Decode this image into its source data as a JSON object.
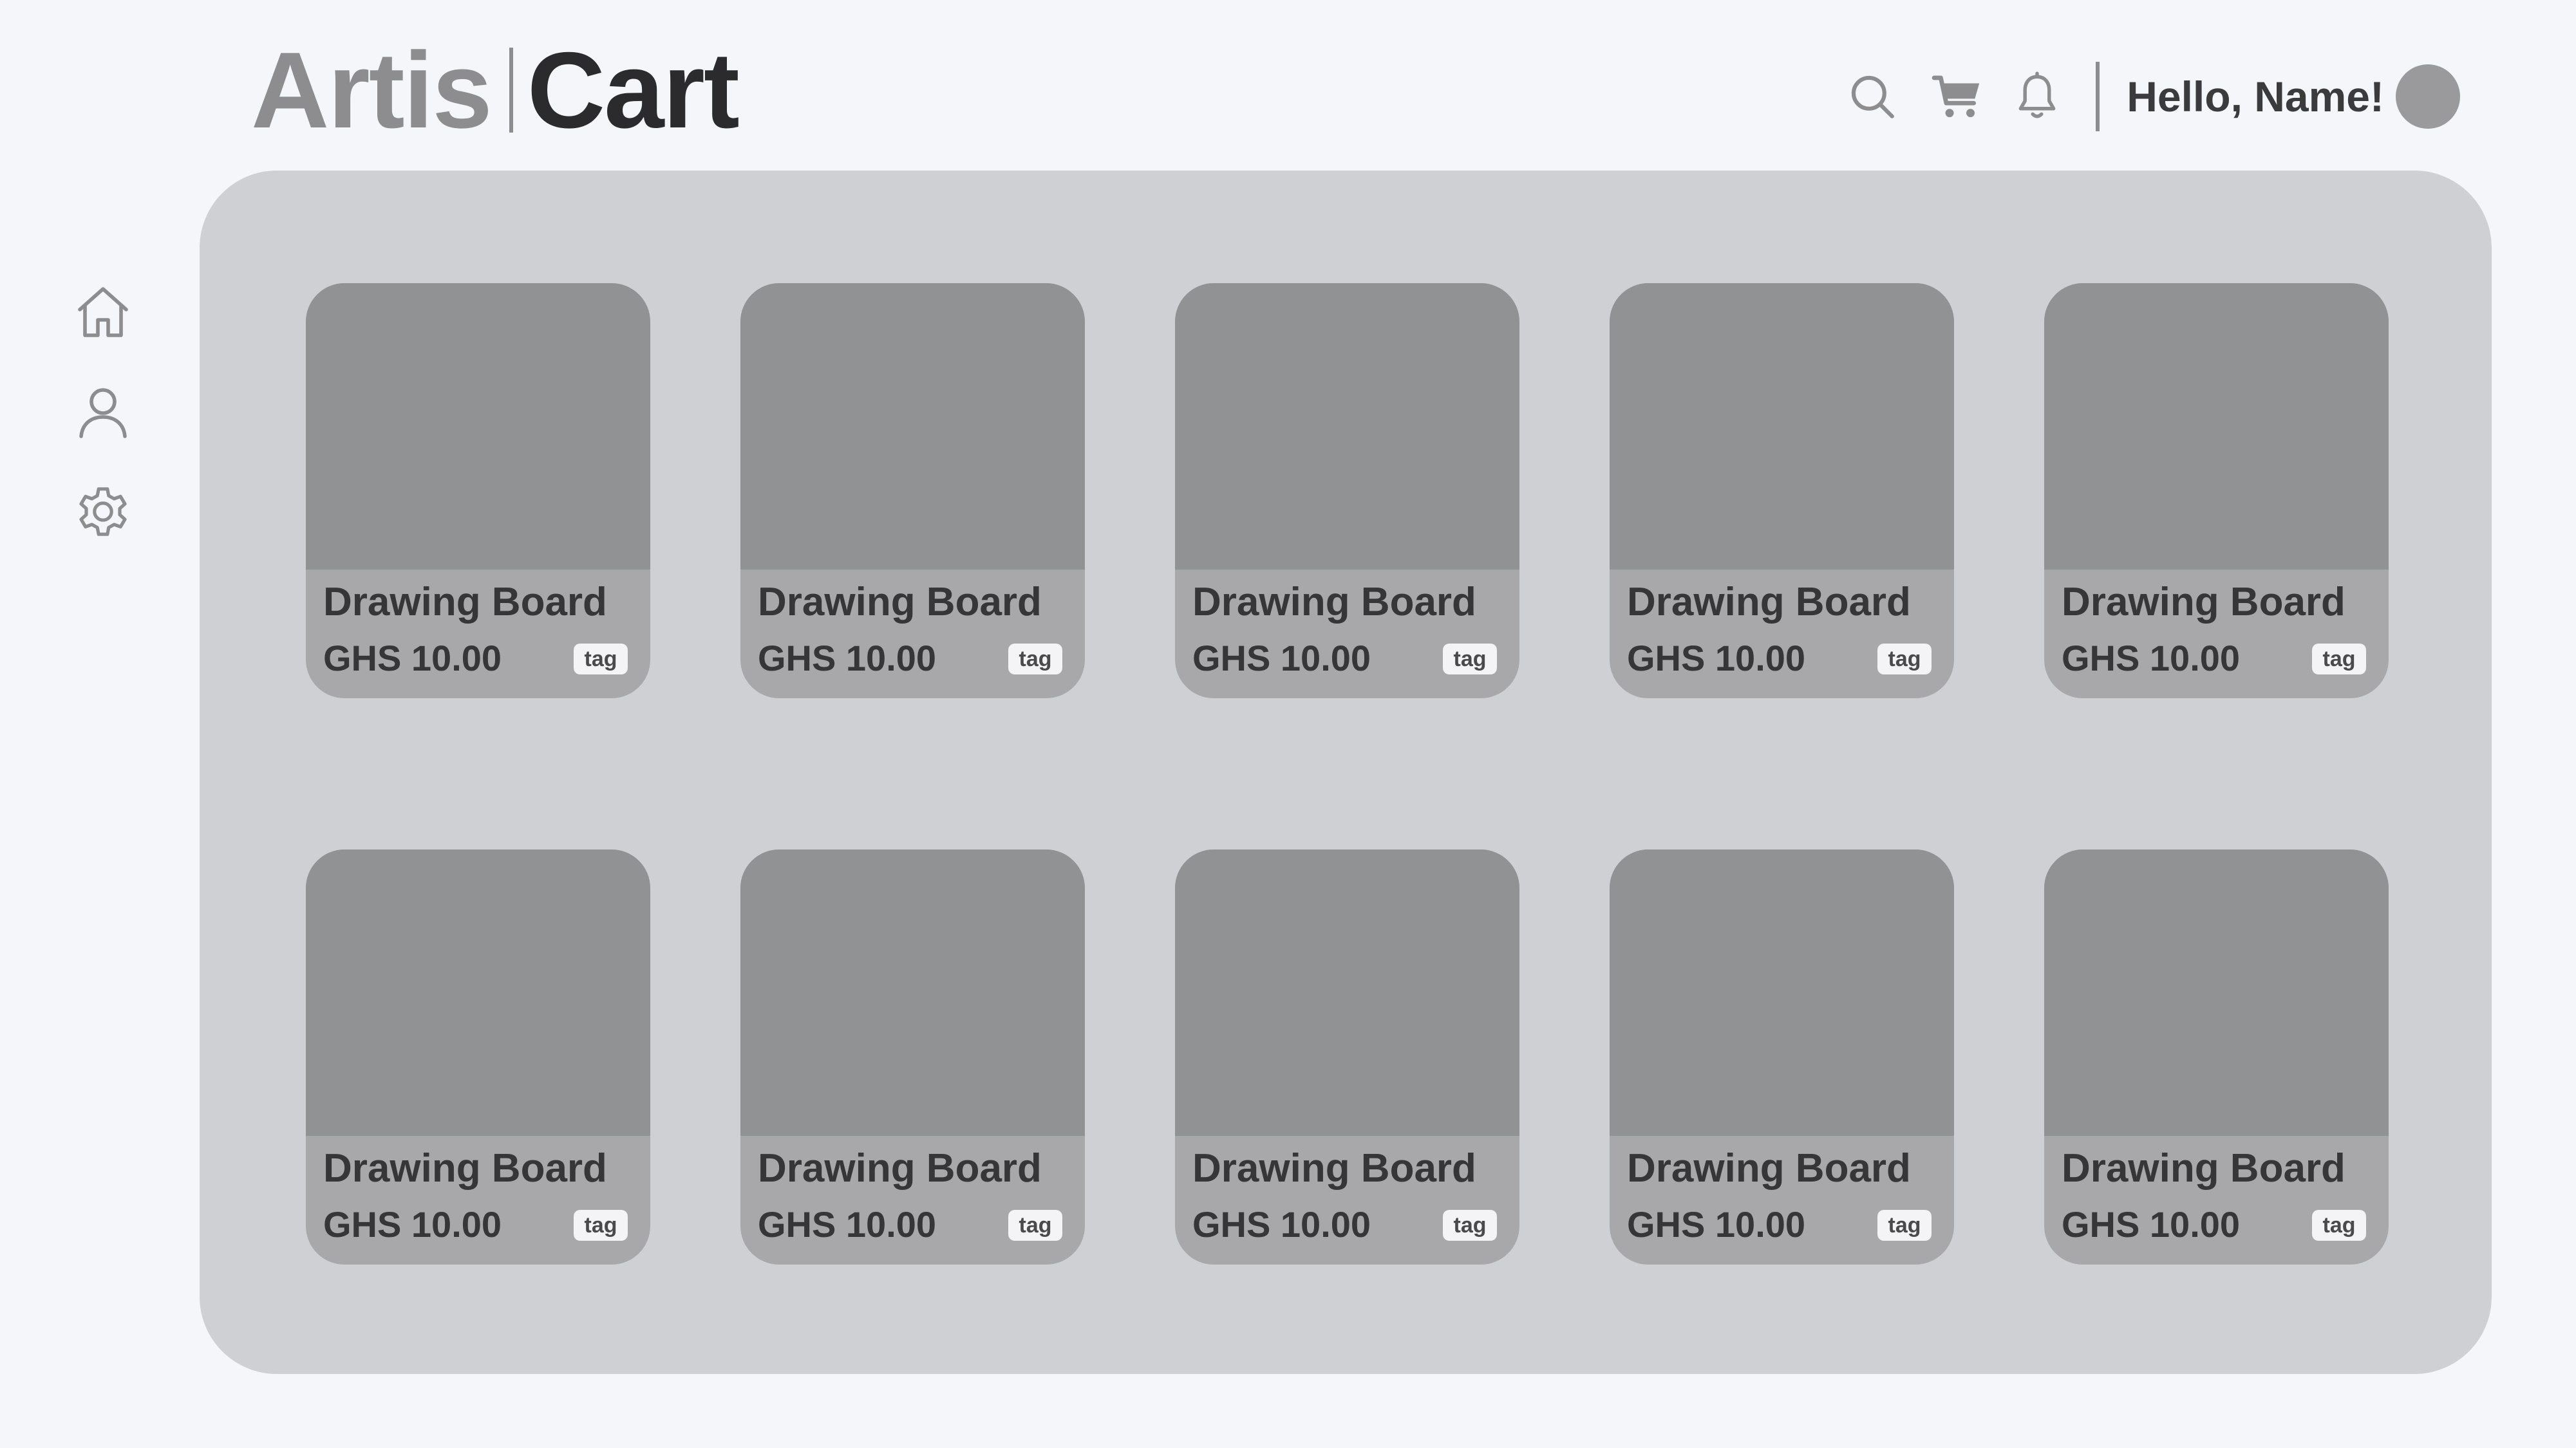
{
  "header": {
    "logo": {
      "part1": "Artis",
      "part2": "Cart"
    },
    "icons": [
      "search-icon",
      "cart-icon",
      "bell-icon"
    ],
    "greeting": "Hello, Name!"
  },
  "sidebar": {
    "items": [
      {
        "icon": "home-icon"
      },
      {
        "icon": "user-icon"
      },
      {
        "icon": "gear-icon"
      }
    ]
  },
  "products": [
    {
      "title": "Drawing Board",
      "price": "GHS 10.00",
      "tag": "tag"
    },
    {
      "title": "Drawing Board",
      "price": "GHS 10.00",
      "tag": "tag"
    },
    {
      "title": "Drawing Board",
      "price": "GHS 10.00",
      "tag": "tag"
    },
    {
      "title": "Drawing Board",
      "price": "GHS 10.00",
      "tag": "tag"
    },
    {
      "title": "Drawing Board",
      "price": "GHS 10.00",
      "tag": "tag"
    },
    {
      "title": "Drawing Board",
      "price": "GHS 10.00",
      "tag": "tag"
    },
    {
      "title": "Drawing Board",
      "price": "GHS 10.00",
      "tag": "tag"
    },
    {
      "title": "Drawing Board",
      "price": "GHS 10.00",
      "tag": "tag"
    },
    {
      "title": "Drawing Board",
      "price": "GHS 10.00",
      "tag": "tag"
    },
    {
      "title": "Drawing Board",
      "price": "GHS 10.00",
      "tag": "tag"
    }
  ],
  "colors": {
    "page_background": "#f5f6fa",
    "panel_background": "#cfd0d4",
    "card_image": "#919294",
    "card_footer": "#a8a8aa",
    "logo_light": "#8d8d8f",
    "logo_dark": "#2b2b2d",
    "avatar": "#9a9a9c"
  }
}
